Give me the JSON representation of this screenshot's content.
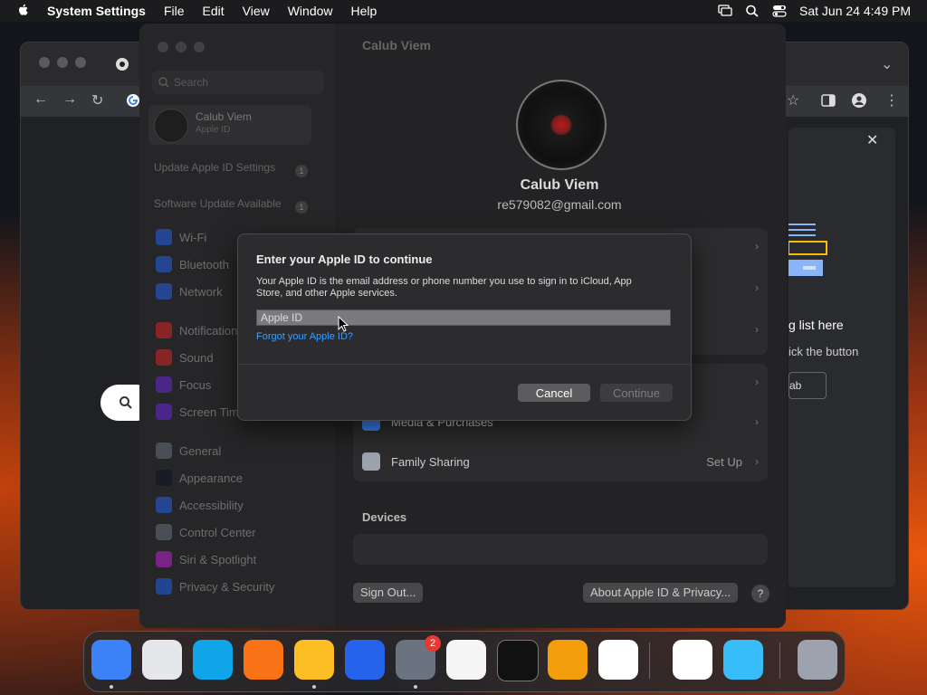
{
  "menubar": {
    "app_name": "System Settings",
    "items": [
      "File",
      "Edit",
      "View",
      "Window",
      "Help"
    ],
    "datetime": "Sat Jun 24  4:49 PM"
  },
  "chrome_panel": {
    "heading_partial": "g list here",
    "desc_partial": "ick the button",
    "button_partial": "ab"
  },
  "settings": {
    "title": "Calub Viem",
    "search_placeholder": "Search",
    "sidebar_user": {
      "name": "Calub Viem",
      "subtitle": "Apple ID"
    },
    "sidebar_rows": [
      {
        "label": "Update Apple ID Settings",
        "badge": "1"
      },
      {
        "label": "Software Update Available",
        "badge": "1"
      }
    ],
    "sidebar_items": [
      {
        "label": "Wi-Fi",
        "color": "#2563eb"
      },
      {
        "label": "Bluetooth",
        "color": "#2563eb"
      },
      {
        "label": "Network",
        "color": "#2563eb"
      },
      {
        "label": "Notifications",
        "color": "#dc2626"
      },
      {
        "label": "Sound",
        "color": "#dc2626"
      },
      {
        "label": "Focus",
        "color": "#6d28d9"
      },
      {
        "label": "Screen Time",
        "color": "#6d28d9"
      },
      {
        "label": "General",
        "color": "#6b7280"
      },
      {
        "label": "Appearance",
        "color": "#111827"
      },
      {
        "label": "Accessibility",
        "color": "#2563eb"
      },
      {
        "label": "Control Center",
        "color": "#6b7280"
      },
      {
        "label": "Siri & Spotlight",
        "color": "#c026d3"
      },
      {
        "label": "Privacy & Security",
        "color": "#2563eb"
      }
    ],
    "user_name": "Calub Viem",
    "user_email": "re579082@gmail.com",
    "rows": [
      {
        "label": "Media & Purchases",
        "value": ""
      },
      {
        "label": "Family Sharing",
        "value": "Set Up"
      }
    ],
    "devices_heading": "Devices",
    "sign_out": "Sign Out...",
    "about": "About Apple ID & Privacy...",
    "help": "?"
  },
  "dialog": {
    "title": "Enter your Apple ID to continue",
    "message": "Your Apple ID is the email address or phone number you use to sign in to iCloud, App Store, and other Apple services.",
    "input_placeholder": "Apple ID",
    "input_value": "",
    "forgot_link": "Forgot your Apple ID?",
    "cancel": "Cancel",
    "continue": "Continue"
  },
  "dock": {
    "apps": [
      "finder",
      "launchpad",
      "safari",
      "firefox",
      "chrome",
      "app-store",
      "system-settings",
      "textedit",
      "terminal",
      "garageband",
      "vscode",
      "visual-studio",
      "weather",
      "trash"
    ],
    "settings_badge": "2"
  }
}
